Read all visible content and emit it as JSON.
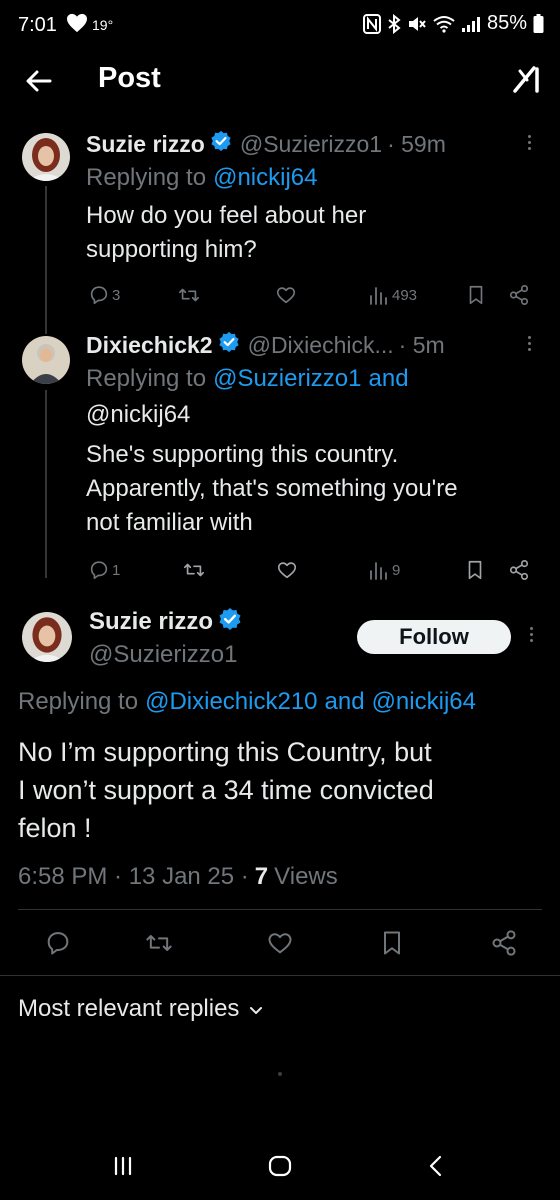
{
  "status_bar": {
    "time": "7:01",
    "temperature": "19°",
    "battery": "85%"
  },
  "header": {
    "title": "Post"
  },
  "tweets": [
    {
      "name": "Suzie rizzo",
      "handle": "@Suzierizzo1",
      "time": "· 59m",
      "replying_prefix": "Replying to",
      "replying_to": "@nickij64",
      "text_line1": "How do you feel about her",
      "text_line2": "supporting him?",
      "replies": "3",
      "views": "493"
    },
    {
      "name": "Dixiechick2",
      "handle": "@Dixiechick...",
      "time": "· 5m",
      "replying_prefix": "Replying to",
      "replying_to_1": "@Suzierizzo1",
      "replying_and": "and",
      "replying_to_2": "@nickij64",
      "text_line1": "She's supporting this country.",
      "text_line2": "Apparently, that's something you're",
      "text_line3": "not familiar with",
      "replies": "1",
      "views": "9"
    }
  ],
  "main_tweet": {
    "name": "Suzie rizzo",
    "handle": "@Suzierizzo1",
    "follow_label": "Follow",
    "replying_prefix": "Replying to",
    "replying_to_1": "@Dixiechick210",
    "replying_and": "and",
    "replying_to_2": "@nickij64",
    "text_line1": "No I’m supporting this Country, but",
    "text_line2": "I won’t support a 34 time convicted",
    "text_line3": "felon !",
    "timestamp": "6:58 PM · 13 Jan 25 ·",
    "views_count": "7",
    "views_label": "Views"
  },
  "replies_sort": {
    "label": "Most relevant replies"
  },
  "colors": {
    "background": "#000000",
    "accent": "#1d9bf0",
    "muted": "#71767b",
    "text": "#e7e9ea"
  },
  "icons": [
    "back-arrow-icon",
    "grok-icon",
    "verified-badge-icon",
    "reply-icon",
    "retweet-icon",
    "like-icon",
    "views-icon",
    "bookmark-icon",
    "share-icon",
    "more-icon",
    "chevron-down-icon"
  ]
}
